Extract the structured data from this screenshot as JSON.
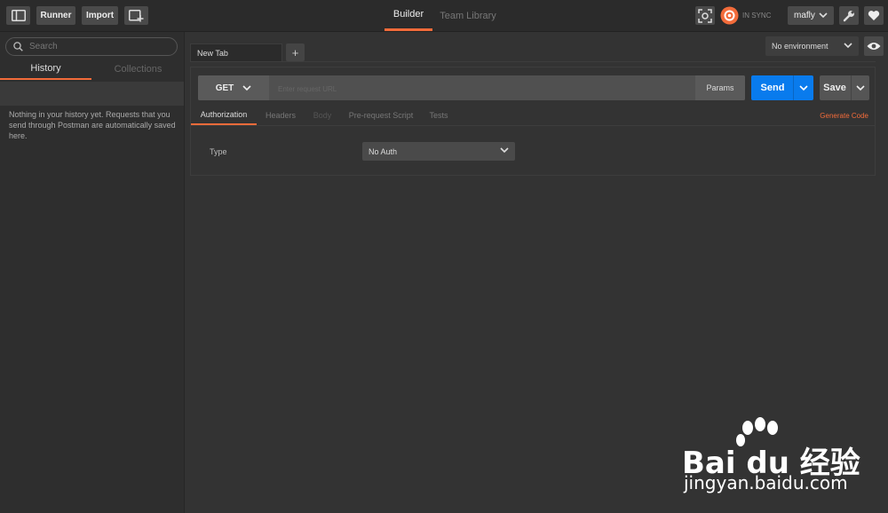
{
  "topbar": {
    "runner_label": "Runner",
    "import_label": "Import",
    "tabs": [
      {
        "label": "Builder",
        "active": true
      },
      {
        "label": "Team Library",
        "active": false
      }
    ],
    "sync_status": "IN SYNC",
    "username": "mafly",
    "icons": [
      "sidebar-toggle-icon",
      "new-window-icon",
      "interceptor-icon",
      "sync-icon",
      "chevron-down-icon",
      "wrench-icon",
      "heart-icon"
    ]
  },
  "sidebar": {
    "search_placeholder": "Search",
    "tabs": [
      {
        "label": "History",
        "active": true
      },
      {
        "label": "Collections",
        "active": false
      }
    ],
    "empty_message": "Nothing in your history yet. Requests that you send through Postman are automatically saved here."
  },
  "request_tabs": {
    "tabs": [
      {
        "label": "New Tab",
        "active": true
      }
    ],
    "add_label": "+"
  },
  "environment": {
    "selected": "No environment"
  },
  "request": {
    "method": "GET",
    "url_placeholder": "Enter request URL",
    "url_value": "",
    "params_label": "Params",
    "send_label": "Send",
    "save_label": "Save"
  },
  "sub_tabs": [
    {
      "label": "Authorization",
      "state": "active"
    },
    {
      "label": "Headers",
      "state": "inactive"
    },
    {
      "label": "Body",
      "state": "disabled"
    },
    {
      "label": "Pre-request Script",
      "state": "inactive"
    },
    {
      "label": "Tests",
      "state": "inactive"
    }
  ],
  "generate_code_label": "Generate Code",
  "auth": {
    "type_label": "Type",
    "selected": "No Auth"
  },
  "watermark": {
    "brand": "Bai du 经验",
    "url": "jingyan.baidu.com"
  },
  "colors": {
    "accent": "#f26b3a",
    "send": "#097bed",
    "background": "#333333"
  }
}
